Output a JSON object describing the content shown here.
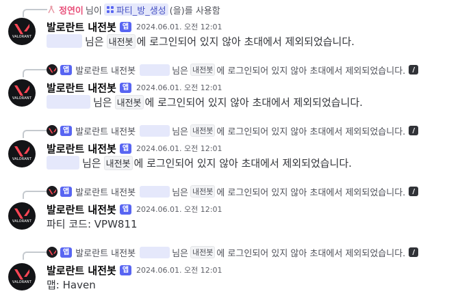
{
  "bot": {
    "name": "발로란트 내전봇",
    "badge": "앱",
    "avatar_label": "VALORANT",
    "brand_color": "#ff4655"
  },
  "command_reply": {
    "user_icon": "person-icon",
    "user": "정연이",
    "used_prefix": "님이",
    "command": "파티_방_생성",
    "used_suffix": "(을)를 사용함"
  },
  "messages": [
    {
      "timestamp": "2024.06.01. 오전 12:01",
      "mention_width": 52,
      "text_before": "님은",
      "code": "내전봇",
      "text_after": "에 로그인되어 있지 않아 초대에서 제외되었습니다."
    },
    {
      "reply": {
        "name": "발로란트 내전봇",
        "badge": "앱",
        "text_before": "님은",
        "code": "내전봇",
        "text_after": "에 로그인되어 있지 않아 초대에서 제외되었습니다.",
        "icon": "embed-icon"
      },
      "timestamp": "2024.06.01. 오전 12:01",
      "mention_width": 64,
      "text_before": "님은",
      "code": "내전봇",
      "text_after": "에 로그인되어 있지 않아 초대에서 제외되었습니다."
    },
    {
      "reply": {
        "name": "발로란트 내전봇",
        "badge": "앱",
        "text_before": "님은",
        "code": "내전봇",
        "text_after": "에 로그인되어 있지 않아 초대에서 제외되었습니다.",
        "icon": "embed-icon"
      },
      "timestamp": "2024.06.01. 오전 12:01",
      "mention_width": 48,
      "text_before": "님은",
      "code": "내전봇",
      "text_after": "에 로그인되어 있지 않아 초대에서 제외되었습니다."
    },
    {
      "reply": {
        "name": "발로란트 내전봇",
        "badge": "앱",
        "text_before": "님은",
        "code": "내전봇",
        "text_after": "에 로그인되어 있지 않아 초대에서 제외되었습니다.",
        "icon": "embed-icon"
      },
      "timestamp": "2024.06.01. 오전 12:01",
      "content": "파티 코드: VPW811"
    },
    {
      "reply": {
        "name": "발로란트 내전봇",
        "badge": "앱",
        "text_before": "님은",
        "code": "내전봇",
        "text_after": "에 로그인되어 있지 않아 초대에서 제외되었습니다.",
        "icon": "embed-icon"
      },
      "timestamp": "2024.06.01. 오전 12:01",
      "content": "맵: Haven"
    }
  ]
}
